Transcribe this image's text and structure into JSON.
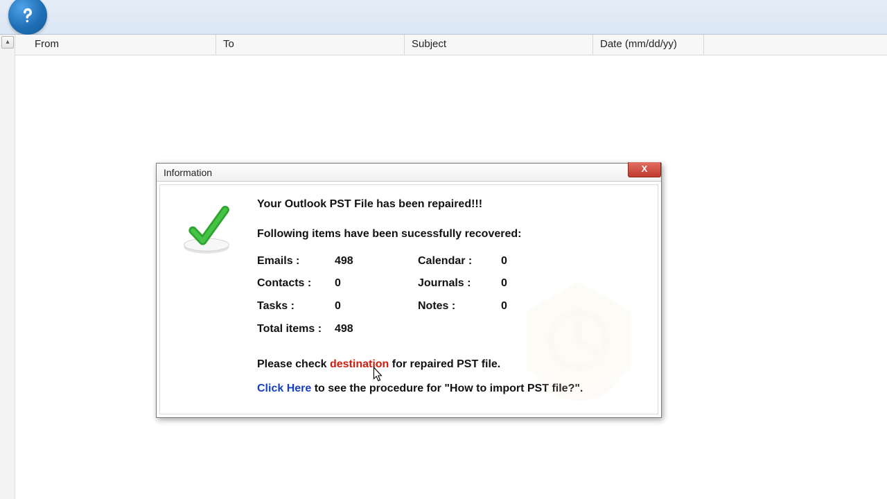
{
  "ribbon": {
    "help_icon": "help-icon"
  },
  "columns": {
    "from": "From",
    "to": "To",
    "subject": "Subject",
    "date": "Date (mm/dd/yy)"
  },
  "dialog": {
    "title": "Information",
    "close_glyph": "X",
    "headline": "Your Outlook PST File has been repaired!!!",
    "sub": "Following items have been sucessfully recovered:",
    "stats": {
      "emails_label": "Emails :",
      "emails_value": "498",
      "calendar_label": "Calendar :",
      "calendar_value": "0",
      "contacts_label": "Contacts :",
      "contacts_value": "0",
      "journals_label": "Journals :",
      "journals_value": "0",
      "tasks_label": "Tasks :",
      "tasks_value": "0",
      "notes_label": "Notes :",
      "notes_value": "0",
      "total_label": "Total items :",
      "total_value": "498"
    },
    "dest_prefix": "Please check ",
    "dest_link": "destination",
    "dest_suffix": " for repaired PST file.",
    "click_link": "Click Here",
    "click_suffix": " to see the procedure for \"How to import PST file?\"."
  }
}
